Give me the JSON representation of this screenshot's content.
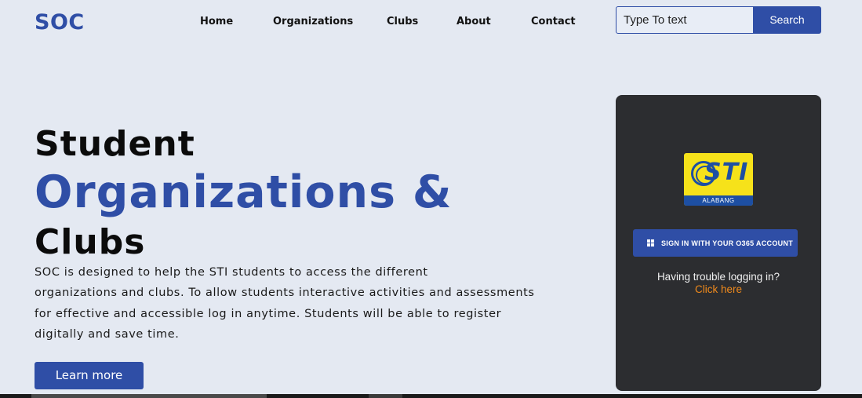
{
  "header": {
    "logo": "SOC",
    "nav": [
      "Home",
      "Organizations",
      "Clubs",
      "About",
      "Contact"
    ],
    "search": {
      "placeholder": "Type To text",
      "button_label": "Search"
    }
  },
  "hero": {
    "line1": "Student",
    "line2": "Organizations &",
    "line3": "Clubs",
    "description_lines": [
      "SOC is designed to help the STI students to access the different",
      "organizations and clubs. To allow students interactive activities and assessments",
      "for effective and accessible log in anytime. Students will be able to register",
      "digitally and save time."
    ],
    "learn_more_label": "Learn more"
  },
  "login_card": {
    "logo": {
      "brand": "STI",
      "campus": "ALABANG"
    },
    "signin_label": "SIGN IN WITH YOUR O365 ACCOUNT",
    "signin_icon": "microsoft-windows-icon",
    "trouble_text": "Having trouble logging in?",
    "click_here": "Click here"
  },
  "colors": {
    "accent": "#2f4ea6",
    "background": "#e4e9f2",
    "card": "#2c2d30",
    "link": "#f08a1c",
    "logo_yellow": "#f6e21a"
  }
}
